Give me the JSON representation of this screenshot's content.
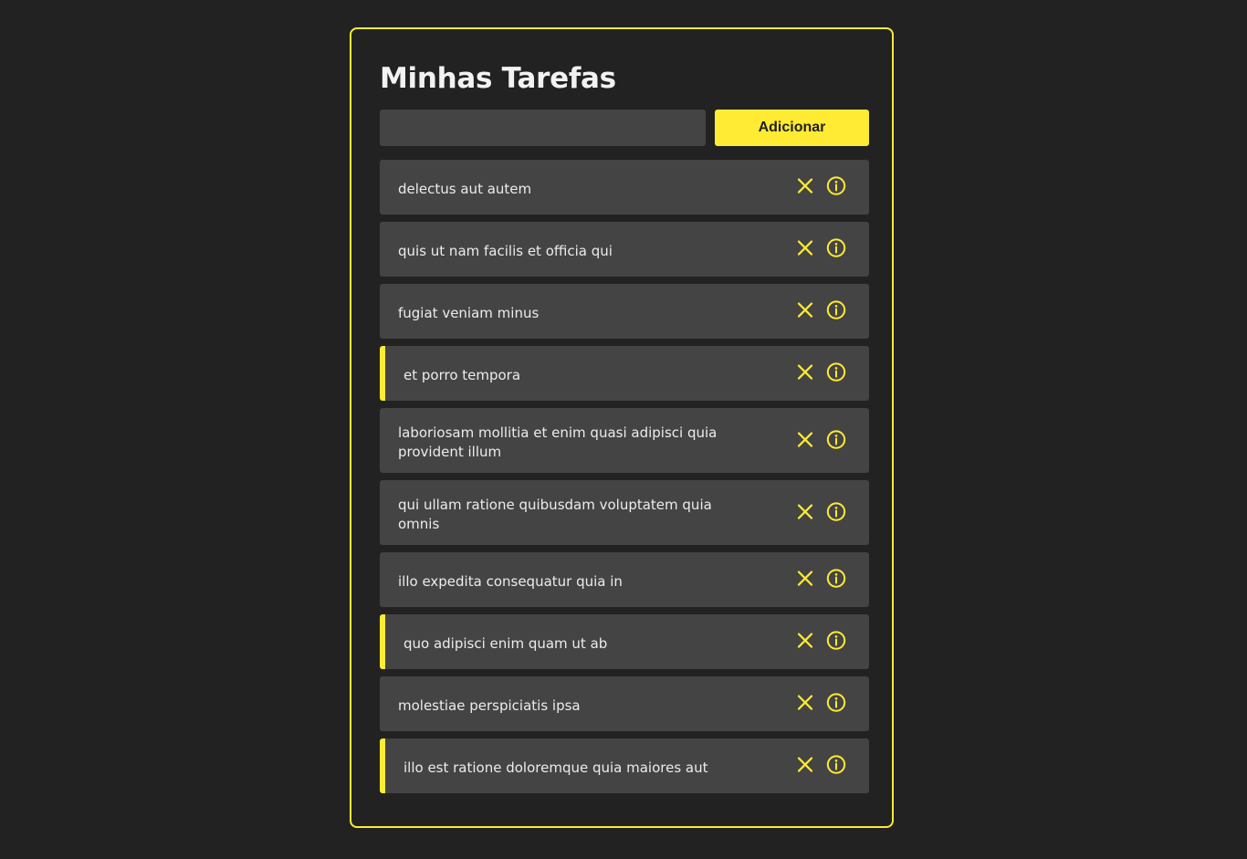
{
  "header": {
    "title": "Minhas Tarefas"
  },
  "add_form": {
    "input_value": "",
    "input_placeholder": "",
    "button_label": "Adicionar"
  },
  "colors": {
    "accent": "#ffeb33",
    "background": "#222222",
    "surface": "#444444",
    "text": "#ececec"
  },
  "tasks": [
    {
      "text": "delectus aut autem",
      "completed": false,
      "icons": [
        "close-icon",
        "info-icon"
      ]
    },
    {
      "text": "quis ut nam facilis et officia qui",
      "completed": false,
      "icons": [
        "close-icon",
        "info-icon"
      ]
    },
    {
      "text": "fugiat veniam minus",
      "completed": false,
      "icons": [
        "close-icon",
        "info-icon"
      ]
    },
    {
      "text": "et porro tempora",
      "completed": true,
      "icons": [
        "close-icon",
        "info-icon"
      ]
    },
    {
      "text": "laboriosam mollitia et enim quasi adipisci quia provident illum",
      "completed": false,
      "icons": [
        "close-icon",
        "info-icon"
      ]
    },
    {
      "text": "qui ullam ratione quibusdam voluptatem quia omnis",
      "completed": false,
      "icons": [
        "close-icon",
        "info-icon"
      ]
    },
    {
      "text": "illo expedita consequatur quia in",
      "completed": false,
      "icons": [
        "close-icon",
        "info-icon"
      ]
    },
    {
      "text": "quo adipisci enim quam ut ab",
      "completed": true,
      "icons": [
        "close-icon",
        "info-icon"
      ]
    },
    {
      "text": "molestiae perspiciatis ipsa",
      "completed": false,
      "icons": [
        "close-icon",
        "info-icon"
      ]
    },
    {
      "text": "illo est ratione doloremque quia maiores aut",
      "completed": true,
      "icons": [
        "close-icon",
        "info-icon"
      ]
    }
  ]
}
